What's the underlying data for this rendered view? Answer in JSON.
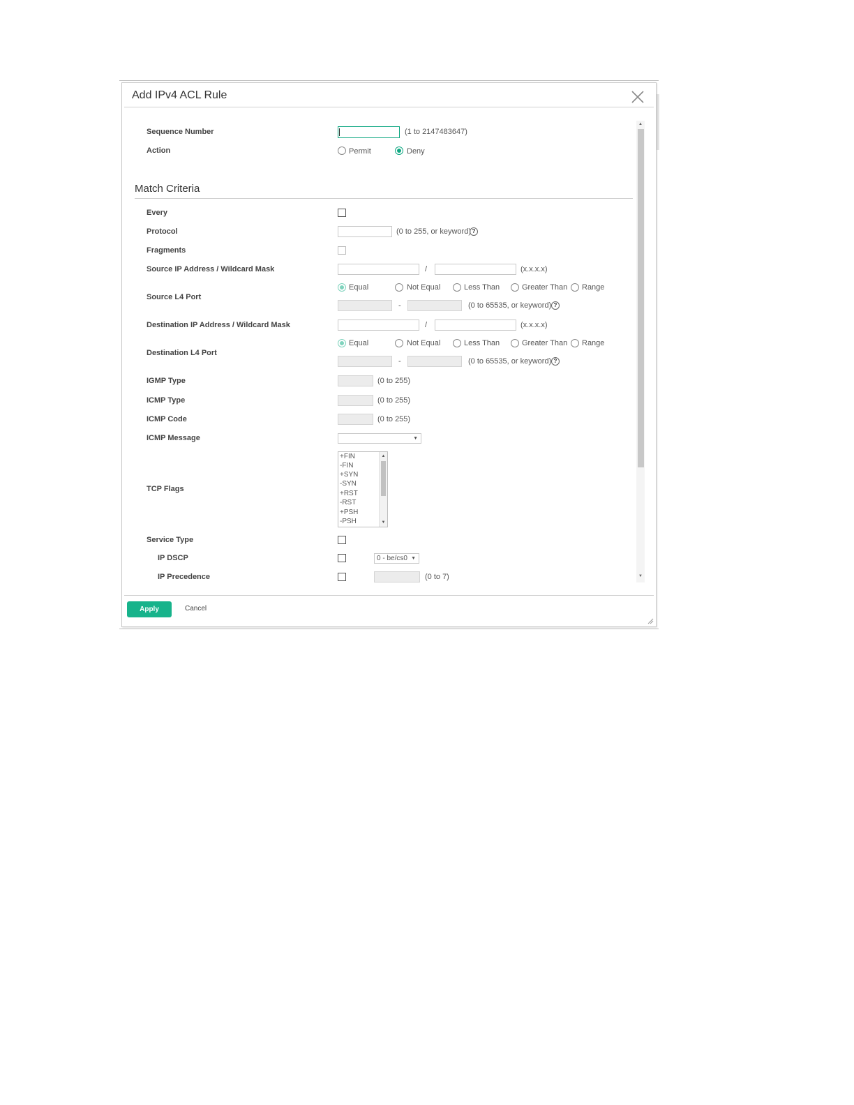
{
  "dialog": {
    "title": "Add IPv4 ACL Rule",
    "close_icon": "close-icon"
  },
  "colors": {
    "accent": "#17b38b"
  },
  "fields": {
    "sequence_number": {
      "label": "Sequence Number",
      "value": "",
      "hint": "(1 to 2147483647)"
    },
    "action": {
      "label": "Action",
      "options": [
        "Permit",
        "Deny"
      ],
      "selected": "Deny"
    }
  },
  "match": {
    "title": "Match Criteria",
    "every": {
      "label": "Every",
      "checked": false
    },
    "protocol": {
      "label": "Protocol",
      "value": "",
      "hint": "(0 to 255, or keyword)"
    },
    "fragments": {
      "label": "Fragments",
      "checked": false
    },
    "source_ip": {
      "label": "Source IP Address / Wildcard Mask",
      "separator": "/",
      "hint": "(x.x.x.x)"
    },
    "source_l4": {
      "label": "Source L4 Port",
      "options": [
        "Equal",
        "Not Equal",
        "Less Than",
        "Greater Than",
        "Range"
      ],
      "selected": "Equal",
      "dash": "-",
      "hint": "(0 to 65535, or keyword)"
    },
    "dest_ip": {
      "label": "Destination IP Address / Wildcard Mask",
      "separator": "/",
      "hint": "(x.x.x.x)"
    },
    "dest_l4": {
      "label": "Destination L4 Port",
      "options": [
        "Equal",
        "Not Equal",
        "Less Than",
        "Greater Than",
        "Range"
      ],
      "selected": "Equal",
      "dash": "-",
      "hint": "(0 to 65535, or keyword)"
    },
    "igmp_type": {
      "label": "IGMP Type",
      "hint": "(0 to 255)"
    },
    "icmp_type": {
      "label": "ICMP Type",
      "hint": "(0 to 255)"
    },
    "icmp_code": {
      "label": "ICMP Code",
      "hint": "(0 to 255)"
    },
    "icmp_message": {
      "label": "ICMP Message",
      "value": ""
    },
    "tcp_flags": {
      "label": "TCP Flags",
      "items": [
        "+FIN",
        "-FIN",
        "+SYN",
        "-SYN",
        "+RST",
        "-RST",
        "+PSH",
        "-PSH"
      ]
    },
    "service_type": {
      "label": "Service Type",
      "checked": false
    },
    "ip_dscp": {
      "label": "IP DSCP",
      "checked": false,
      "value": "0 - be/cs0"
    },
    "ip_precedence": {
      "label": "IP Precedence",
      "checked": false,
      "hint": "(0 to 7)"
    },
    "help_symbol": "?"
  },
  "footer": {
    "apply_label": "Apply",
    "cancel_label": "Cancel"
  }
}
